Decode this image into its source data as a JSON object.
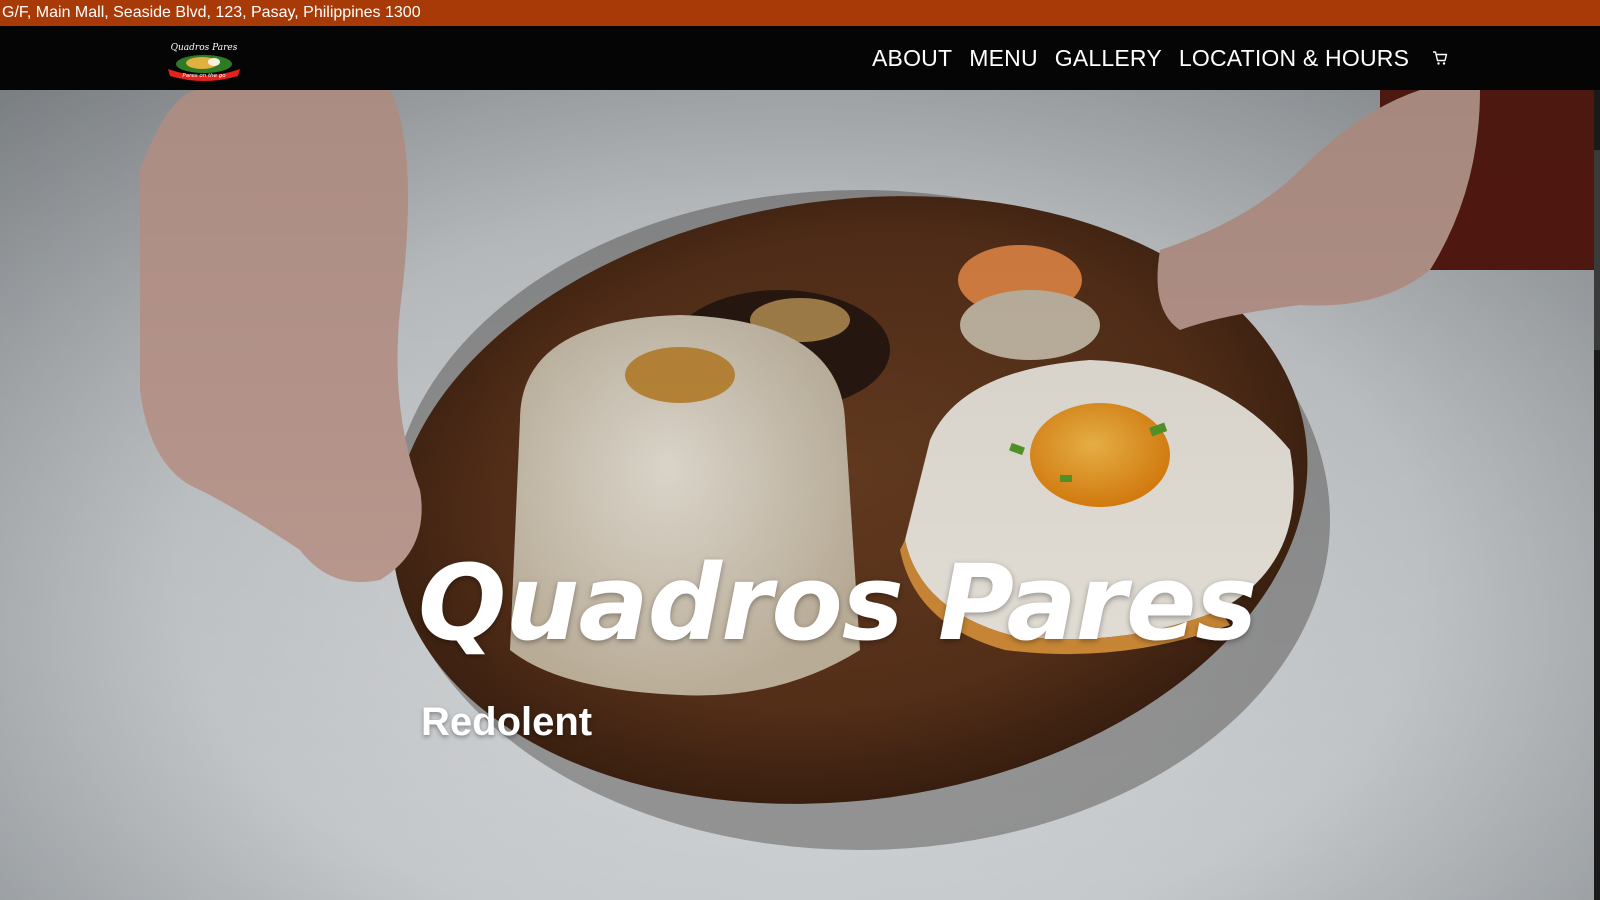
{
  "topbar": {
    "address": "G/F, Main Mall, Seaside Blvd, 123, Pasay, Philippines 1300"
  },
  "header": {
    "logo": {
      "text_top": "Quadros Pares",
      "text_ribbon": "Pares on the go"
    },
    "nav": [
      {
        "label": "ABOUT"
      },
      {
        "label": "MENU"
      },
      {
        "label": "GALLERY"
      },
      {
        "label": "LOCATION & HOURS"
      }
    ],
    "cart_icon": "cart-icon"
  },
  "hero": {
    "title": "Quadros Pares",
    "subtitle": "Redolent"
  },
  "colors": {
    "topbar": "#a83a08",
    "navbar": "#050505",
    "text": "#ffffff"
  }
}
